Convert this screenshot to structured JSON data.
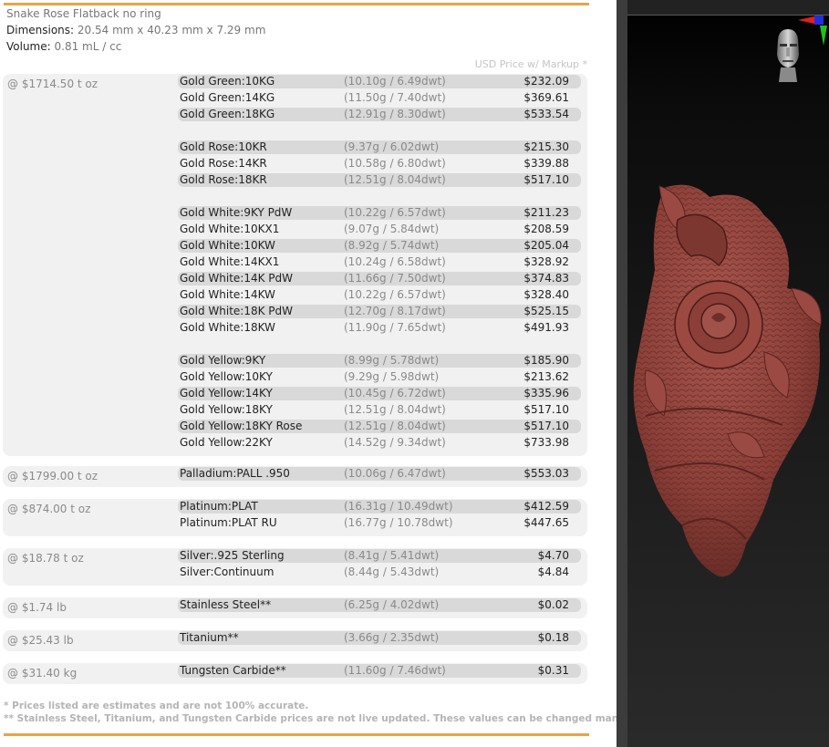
{
  "window": {
    "title": "Snake Rose Flatback no ring",
    "dimensions_label": "Dimensions:",
    "dimensions_value": "20.54 mm x 40.23 mm x 7.29 mm",
    "volume_label": "Volume:",
    "volume_value": "0.81 mL / cc"
  },
  "price_column_header": "USD Price w/ Markup *",
  "groups": [
    {
      "rate": "@ $1714.50 t oz",
      "items": [
        {
          "name": "Gold Green:10KG",
          "weight": "(10.10g / 6.49dwt)",
          "price": "$232.09",
          "shade": true
        },
        {
          "name": "Gold Green:14KG",
          "weight": "(11.50g / 7.40dwt)",
          "price": "$369.61",
          "shade": false
        },
        {
          "name": "Gold Green:18KG",
          "weight": "(12.91g / 8.30dwt)",
          "price": "$533.54",
          "shade": true
        },
        {
          "gap": true
        },
        {
          "name": "Gold Rose:10KR",
          "weight": "(9.37g / 6.02dwt)",
          "price": "$215.30",
          "shade": true
        },
        {
          "name": "Gold Rose:14KR",
          "weight": "(10.58g / 6.80dwt)",
          "price": "$339.88",
          "shade": false
        },
        {
          "name": "Gold Rose:18KR",
          "weight": "(12.51g / 8.04dwt)",
          "price": "$517.10",
          "shade": true
        },
        {
          "gap": true
        },
        {
          "name": "Gold White:9KY PdW",
          "weight": "(10.22g / 6.57dwt)",
          "price": "$211.23",
          "shade": true
        },
        {
          "name": "Gold White:10KX1",
          "weight": "(9.07g / 5.84dwt)",
          "price": "$208.59",
          "shade": false
        },
        {
          "name": "Gold White:10KW",
          "weight": "(8.92g / 5.74dwt)",
          "price": "$205.04",
          "shade": true
        },
        {
          "name": "Gold White:14KX1",
          "weight": "(10.24g / 6.58dwt)",
          "price": "$328.92",
          "shade": false
        },
        {
          "name": "Gold White:14K PdW",
          "weight": "(11.66g / 7.50dwt)",
          "price": "$374.83",
          "shade": true
        },
        {
          "name": "Gold White:14KW",
          "weight": "(10.22g / 6.57dwt)",
          "price": "$328.40",
          "shade": false
        },
        {
          "name": "Gold White:18K PdW",
          "weight": "(12.70g / 8.17dwt)",
          "price": "$525.15",
          "shade": true
        },
        {
          "name": "Gold White:18KW",
          "weight": "(11.90g / 7.65dwt)",
          "price": "$491.93",
          "shade": false
        },
        {
          "gap": true
        },
        {
          "name": "Gold Yellow:9KY",
          "weight": "(8.99g / 5.78dwt)",
          "price": "$185.90",
          "shade": true
        },
        {
          "name": "Gold Yellow:10KY",
          "weight": "(9.29g / 5.98dwt)",
          "price": "$213.62",
          "shade": false
        },
        {
          "name": "Gold Yellow:14KY",
          "weight": "(10.45g / 6.72dwt)",
          "price": "$335.96",
          "shade": true
        },
        {
          "name": "Gold Yellow:18KY",
          "weight": "(12.51g / 8.04dwt)",
          "price": "$517.10",
          "shade": false
        },
        {
          "name": "Gold Yellow:18KY Rose",
          "weight": "(12.51g / 8.04dwt)",
          "price": "$517.10",
          "shade": true
        },
        {
          "name": "Gold Yellow:22KY",
          "weight": "(14.52g / 9.34dwt)",
          "price": "$733.98",
          "shade": false
        }
      ]
    },
    {
      "rate": "@ $1799.00 t oz",
      "items": [
        {
          "name": "Palladium:PALL .950",
          "weight": "(10.06g / 6.47dwt)",
          "price": "$553.03",
          "shade": true
        }
      ]
    },
    {
      "rate": "@ $874.00 t oz",
      "items": [
        {
          "name": "Platinum:PLAT",
          "weight": "(16.31g / 10.49dwt)",
          "price": "$412.59",
          "shade": true
        },
        {
          "name": "Platinum:PLAT RU",
          "weight": "(16.77g / 10.78dwt)",
          "price": "$447.65",
          "shade": false
        }
      ]
    },
    {
      "rate": "@ $18.78 t oz",
      "items": [
        {
          "name": "Silver:.925 Sterling",
          "weight": "(8.41g / 5.41dwt)",
          "price": "$4.70",
          "shade": true
        },
        {
          "name": "Silver:Continuum",
          "weight": "(8.44g / 5.43dwt)",
          "price": "$4.84",
          "shade": false
        }
      ]
    },
    {
      "rate": "@ $1.74 lb",
      "items": [
        {
          "name": "Stainless Steel**",
          "weight": "(6.25g / 4.02dwt)",
          "price": "$0.02",
          "shade": true
        }
      ]
    },
    {
      "rate": "@ $25.43 lb",
      "items": [
        {
          "name": "Titanium**",
          "weight": "(3.66g / 2.35dwt)",
          "price": "$0.18",
          "shade": true
        }
      ]
    },
    {
      "rate": "@ $31.40 kg",
      "items": [
        {
          "name": "Tungsten Carbide**",
          "weight": "(11.60g / 7.46dwt)",
          "price": "$0.31",
          "shade": true
        }
      ]
    }
  ],
  "notes": {
    "estimate": "* Prices listed are estimates and are not 100% accurate.",
    "manual": "** Stainless Steel, Titanium, and Tungsten Carbide prices are not live updated. These values can be changed manually."
  },
  "colors": {
    "accent_rule": "#e8a44a",
    "model_material": "#8b3f38",
    "viewport_background": "#111111"
  },
  "viewport": {
    "model_icon": "snake-rose-pendant-model",
    "view_icon": "head-orientation-icon",
    "axis_icon": "axis-gizmo-icon"
  }
}
